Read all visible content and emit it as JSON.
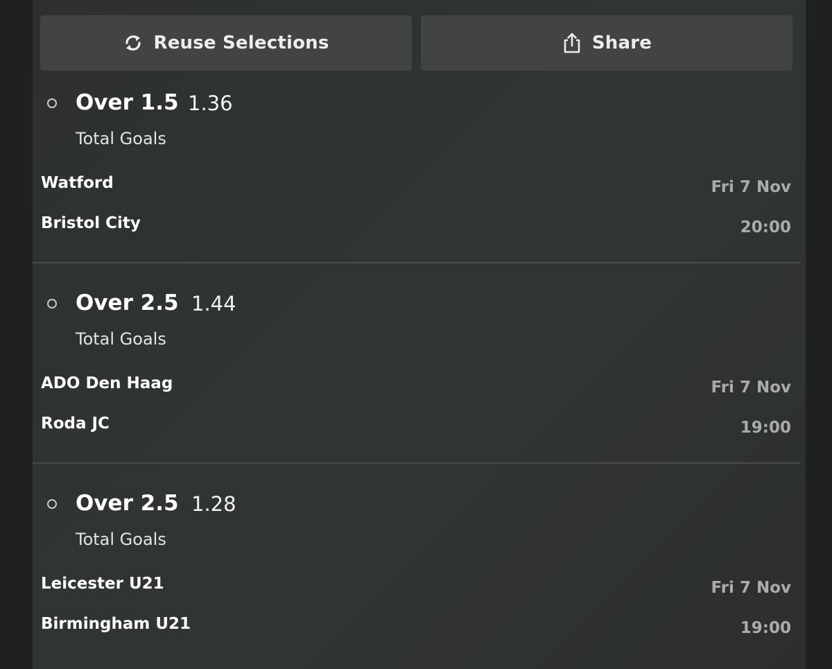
{
  "actions": {
    "reuse_label": "Reuse Selections",
    "share_label": "Share"
  },
  "selections": [
    {
      "market": "Over 1.5",
      "odds": "1.36",
      "type": "Total Goals",
      "home": "Watford",
      "away": "Bristol City",
      "date": "Fri 7 Nov",
      "time": "20:00"
    },
    {
      "market": "Over 2.5",
      "odds": "1.44",
      "type": "Total Goals",
      "home": "ADO Den Haag",
      "away": "Roda JC",
      "date": "Fri 7 Nov",
      "time": "19:00"
    },
    {
      "market": "Over 2.5",
      "odds": "1.28",
      "type": "Total Goals",
      "home": "Leicester U21",
      "away": "Birmingham U21",
      "date": "Fri 7 Nov",
      "time": "19:00"
    }
  ],
  "colors": {
    "panel": "#2f3431",
    "button": "#414443",
    "muted_text": "#a9acab",
    "divider": "#4a4d4c"
  },
  "icons": {
    "reuse": "refresh-icon",
    "share": "share-icon",
    "selection_marker": "radio-circle-icon"
  }
}
